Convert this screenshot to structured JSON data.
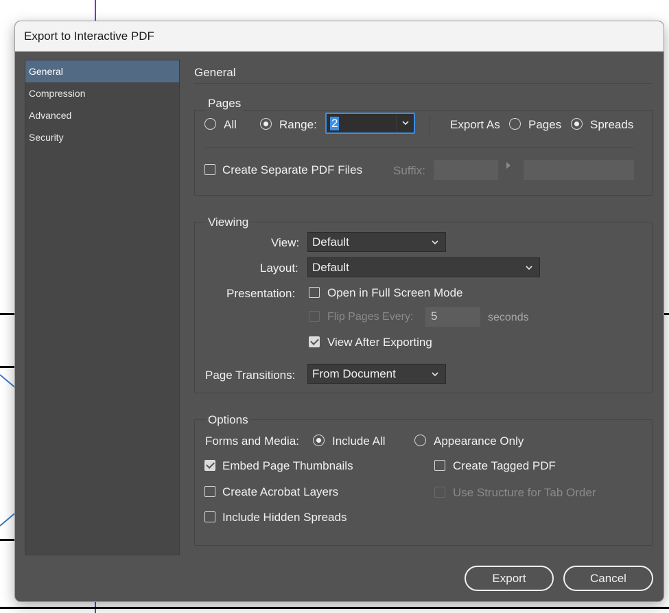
{
  "window": {
    "title": "Export to Interactive PDF"
  },
  "sidebar": {
    "items": [
      {
        "label": "General",
        "active": true
      },
      {
        "label": "Compression",
        "active": false
      },
      {
        "label": "Advanced",
        "active": false
      },
      {
        "label": "Security",
        "active": false
      }
    ]
  },
  "main": {
    "heading": "General"
  },
  "pages": {
    "group_label": "Pages",
    "all_label": "All",
    "range_label": "Range:",
    "range_value": "2",
    "export_as_label": "Export As",
    "export_pages_label": "Pages",
    "export_spreads_label": "Spreads",
    "separate_pdf_label": "Create Separate PDF Files",
    "suffix_label": "Suffix:"
  },
  "viewing": {
    "group_label": "Viewing",
    "view_label": "View:",
    "view_value": "Default",
    "layout_label": "Layout:",
    "layout_value": "Default",
    "presentation_label": "Presentation:",
    "fullscreen_label": "Open in Full Screen Mode",
    "flip_label": "Flip Pages Every:",
    "flip_value": "5",
    "seconds_label": "seconds",
    "view_after_label": "View After Exporting",
    "transitions_label": "Page Transitions:",
    "transitions_value": "From Document"
  },
  "options": {
    "group_label": "Options",
    "forms_label": "Forms and Media:",
    "include_all_label": "Include All",
    "appearance_only_label": "Appearance Only",
    "embed_thumbnails_label": "Embed Page Thumbnails",
    "tagged_pdf_label": "Create Tagged PDF",
    "acrobat_layers_label": "Create Acrobat Layers",
    "tab_order_label": "Use Structure for Tab Order",
    "hidden_spreads_label": "Include Hidden Spreads"
  },
  "buttons": {
    "export_label": "Export",
    "cancel_label": "Cancel"
  },
  "colors": {
    "dialog_bg": "#535353",
    "accent": "#3a8ee6",
    "selected_item": "#536a85"
  }
}
